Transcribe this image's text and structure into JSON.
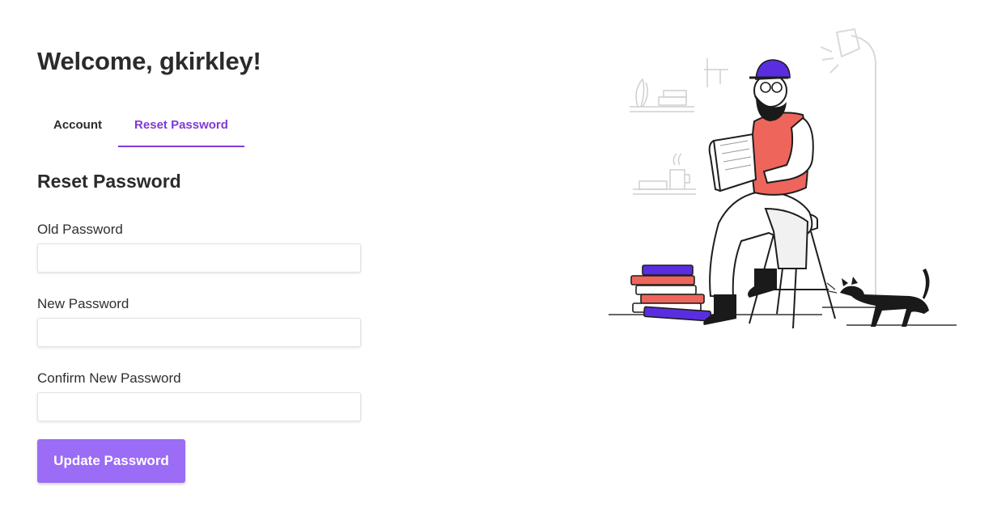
{
  "header": {
    "welcome": "Welcome, gkirkley!"
  },
  "tabs": [
    {
      "label": "Account",
      "active": false
    },
    {
      "label": "Reset Password",
      "active": true
    }
  ],
  "form": {
    "title": "Reset Password",
    "fields": [
      {
        "label": "Old Password",
        "value": "",
        "placeholder": ""
      },
      {
        "label": "New Password",
        "value": "",
        "placeholder": ""
      },
      {
        "label": "Confirm New Password",
        "value": "",
        "placeholder": ""
      }
    ],
    "submit_label": "Update Password"
  },
  "colors": {
    "accent": "#7e3bd6",
    "button": "#9b6cf5",
    "shirt": "#ee655c",
    "cap": "#5a2ee0"
  },
  "illustration": {
    "icon": "reading-man-with-cat-illustration"
  }
}
